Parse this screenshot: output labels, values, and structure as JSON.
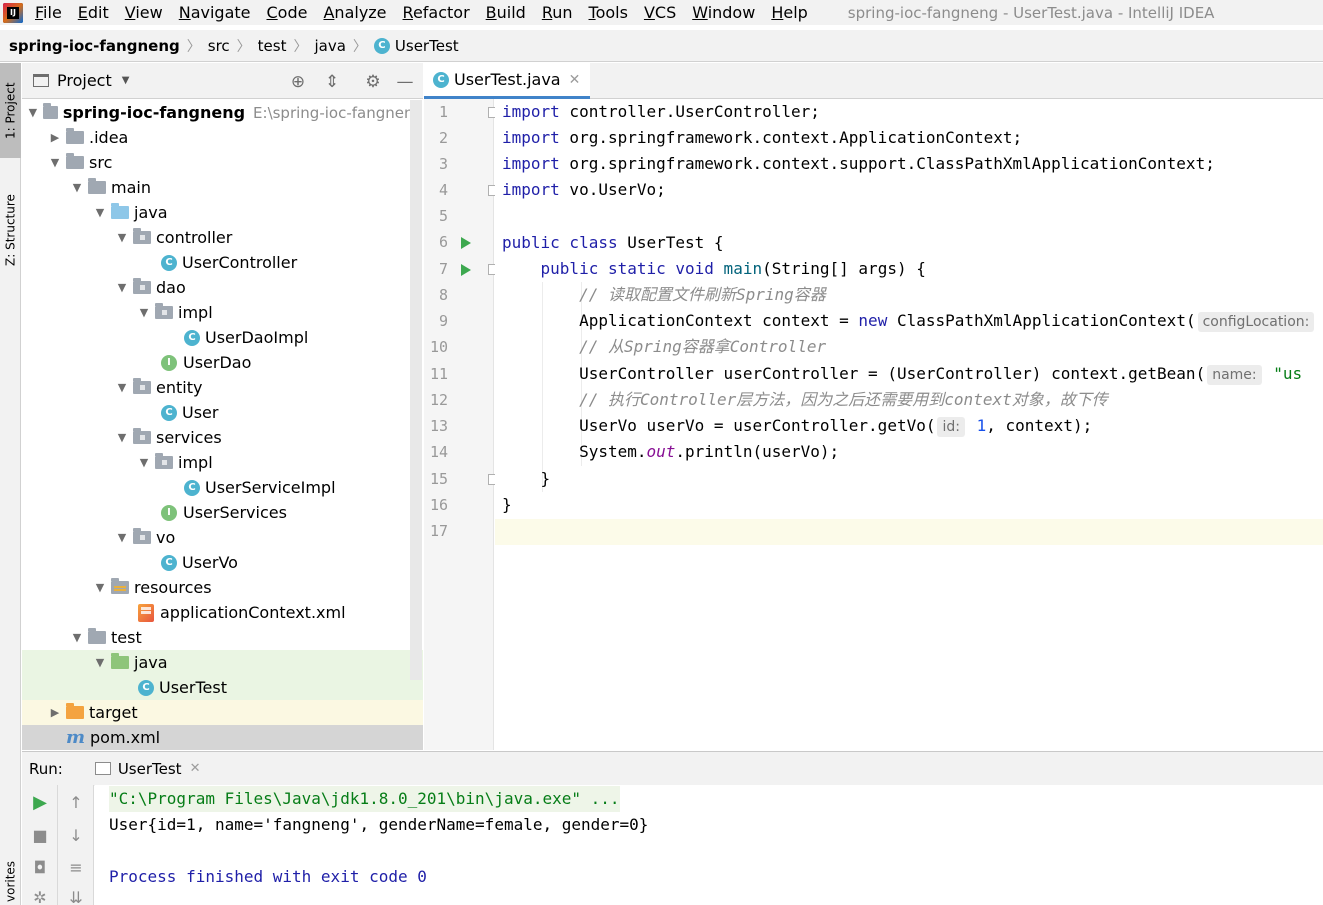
{
  "menu": {
    "items": [
      "File",
      "Edit",
      "View",
      "Navigate",
      "Code",
      "Analyze",
      "Refactor",
      "Build",
      "Run",
      "Tools",
      "VCS",
      "Window",
      "Help"
    ],
    "window_title": "spring-ioc-fangneng - UserTest.java - IntelliJ IDEA"
  },
  "breadcrumbs": [
    "spring-ioc-fangneng",
    "src",
    "test",
    "java",
    "UserTest"
  ],
  "left_strip": {
    "project_tab": "1: Project",
    "structure_tab": "Z: Structure",
    "favorites_tab": "vorites"
  },
  "project_panel": {
    "title": "Project",
    "tree": [
      {
        "label": "spring-ioc-fangneng",
        "path": "E:\\spring-ioc-fangneng",
        "icon": "module-folder-icon",
        "expanded": true,
        "bold": true
      },
      {
        "label": ".idea",
        "icon": "folder-icon",
        "expanded": false
      },
      {
        "label": "src",
        "icon": "folder-icon",
        "expanded": true
      },
      {
        "label": "main",
        "icon": "folder-icon",
        "expanded": true
      },
      {
        "label": "java",
        "icon": "source-folder-icon",
        "expanded": true
      },
      {
        "label": "controller",
        "icon": "package-icon",
        "expanded": true
      },
      {
        "label": "UserController",
        "icon": "class-icon"
      },
      {
        "label": "dao",
        "icon": "package-icon",
        "expanded": true
      },
      {
        "label": "impl",
        "icon": "package-icon",
        "expanded": true
      },
      {
        "label": "UserDaoImpl",
        "icon": "class-icon"
      },
      {
        "label": "UserDao",
        "icon": "interface-icon"
      },
      {
        "label": "entity",
        "icon": "package-icon",
        "expanded": true
      },
      {
        "label": "User",
        "icon": "class-icon"
      },
      {
        "label": "services",
        "icon": "package-icon",
        "expanded": true
      },
      {
        "label": "impl",
        "icon": "package-icon",
        "expanded": true
      },
      {
        "label": "UserServiceImpl",
        "icon": "class-icon"
      },
      {
        "label": "UserServices",
        "icon": "interface-icon"
      },
      {
        "label": "vo",
        "icon": "package-icon",
        "expanded": true
      },
      {
        "label": "UserVo",
        "icon": "class-icon"
      },
      {
        "label": "resources",
        "icon": "resources-folder-icon",
        "expanded": true
      },
      {
        "label": "applicationContext.xml",
        "icon": "xml-file-icon"
      },
      {
        "label": "test",
        "icon": "folder-icon",
        "expanded": true
      },
      {
        "label": "java",
        "icon": "test-source-folder-icon",
        "expanded": true
      },
      {
        "label": "UserTest",
        "icon": "test-class-icon"
      },
      {
        "label": "target",
        "icon": "excluded-folder-icon",
        "expanded": false
      },
      {
        "label": "pom.xml",
        "icon": "maven-icon"
      }
    ]
  },
  "editor": {
    "tab_label": "UserTest.java",
    "line_numbers": [
      "1",
      "2",
      "3",
      "4",
      "5",
      "6",
      "7",
      "8",
      "9",
      "10",
      "11",
      "12",
      "13",
      "14",
      "15",
      "16",
      "17"
    ],
    "code": {
      "l1_kw": "import",
      "l1_rest": " controller.UserController;",
      "l2_kw": "import",
      "l2_rest": " org.springframework.context.ApplicationContext;",
      "l3_kw": "import",
      "l3_rest": " org.springframework.context.support.ClassPathXmlApplicationContext;",
      "l4_kw": "import",
      "l4_rest": " vo.UserVo;",
      "l6_kw": "public class",
      "l6_rest": " UserTest {",
      "l7_indent": "    ",
      "l7_kw": "public static void",
      "l7_name": " main",
      "l7_rest": "(String[] args) {",
      "l8": "        // 读取配置文件刷新Spring容器",
      "l9_a": "        ApplicationContext context = ",
      "l9_kw": "new",
      "l9_b": " ClassPathXmlApplicationContext(",
      "l9_hint": "configLocation:",
      "l10": "        // 从Spring容器拿Controller",
      "l11_a": "        UserController userController = (UserController) context.getBean(",
      "l11_hint": "name:",
      "l11_str": " \"us",
      "l12": "        // 执行Controller层方法，因为之后还需要用到context对象，故下传",
      "l13_a": "        UserVo userVo = userController.getVo(",
      "l13_hint": "id:",
      "l13_num": " 1",
      "l13_b": ", context);",
      "l14_a": "        System.",
      "l14_field": "out",
      "l14_b": ".println(userVo);",
      "l15": "    }",
      "l16": "}"
    }
  },
  "run_panel": {
    "label": "Run:",
    "tab_label": "UserTest",
    "console": [
      "\"C:\\Program Files\\Java\\jdk1.8.0_201\\bin\\java.exe\" ...",
      "User{id=1, name='fangneng', genderName=female, gender=0}",
      "",
      "Process finished with exit code 0"
    ]
  },
  "colors": {
    "keyword": "#1f1fa8",
    "comment": "#8c8c8c",
    "string": "#067d17",
    "run_green": "#3da84f",
    "tab_underline": "#4083c9"
  }
}
